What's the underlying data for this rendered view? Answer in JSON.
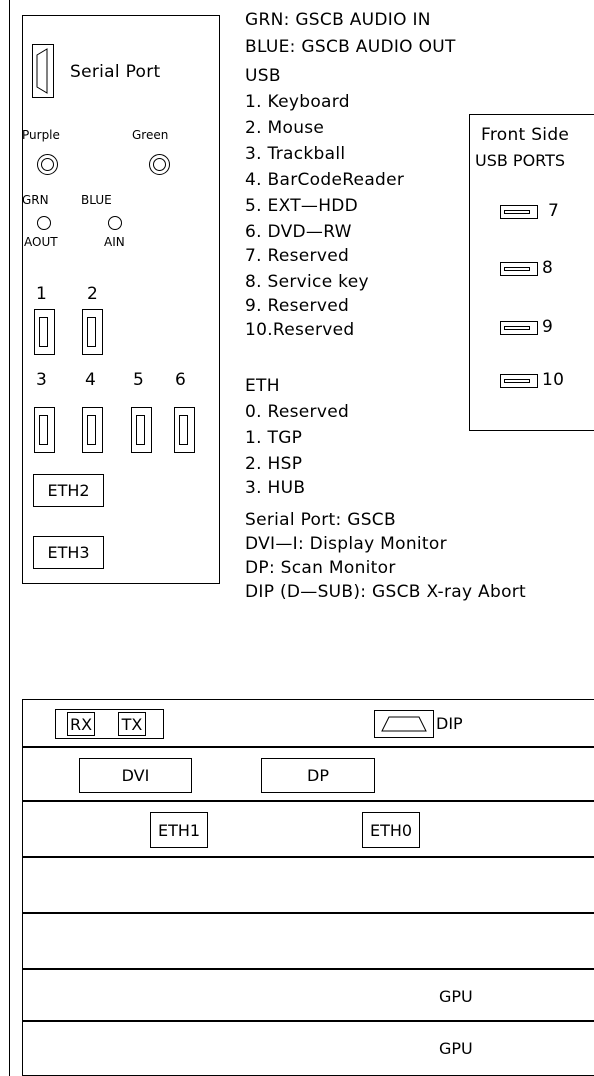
{
  "left_panel": {
    "serial_port_label": "Serial Port",
    "purple_label": "Purple",
    "green_label": "Green",
    "grn_label": "GRN",
    "blue_label": "BLUE",
    "aout_label": "AOUT",
    "ain_label": "AIN",
    "usb_numbers": [
      "1",
      "2",
      "3",
      "4",
      "5",
      "6"
    ],
    "eth2_label": "ETH2",
    "eth3_label": "ETH3"
  },
  "legend": {
    "audio_lines": [
      "GRN: GSCB AUDIO IN",
      "BLUE: GSCB AUDIO OUT"
    ],
    "usb_heading": "USB",
    "usb_items": [
      "1. Keyboard",
      "2. Mouse",
      "3. Trackball",
      "4. BarCodeReader",
      "5. EXT—HDD",
      "6. DVD—RW",
      "7. Reserved",
      "8. Service key",
      "9. Reserved",
      "10.Reserved"
    ],
    "eth_heading": "ETH",
    "eth_items": [
      "0. Reserved",
      "1. TGP",
      "2. HSP",
      "3. HUB"
    ],
    "other_lines": [
      "Serial Port: GSCB",
      "DVI—I: Display Monitor",
      "DP: Scan Monitor",
      "DIP (D—SUB): GSCB X-ray Abort"
    ]
  },
  "front_usb": {
    "title_line1": "Front Side",
    "title_line2": "USB PORTS",
    "ports": [
      "7",
      "8",
      "9",
      "10"
    ]
  },
  "bottom_panel": {
    "rx_label": "RX",
    "tx_label": "TX",
    "dip_label": "DIP",
    "dvi_label": "DVI",
    "dp_label": "DP",
    "eth1_label": "ETH1",
    "eth0_label": "ETH0",
    "gpu1_label": "GPU",
    "gpu2_label": "GPU"
  }
}
